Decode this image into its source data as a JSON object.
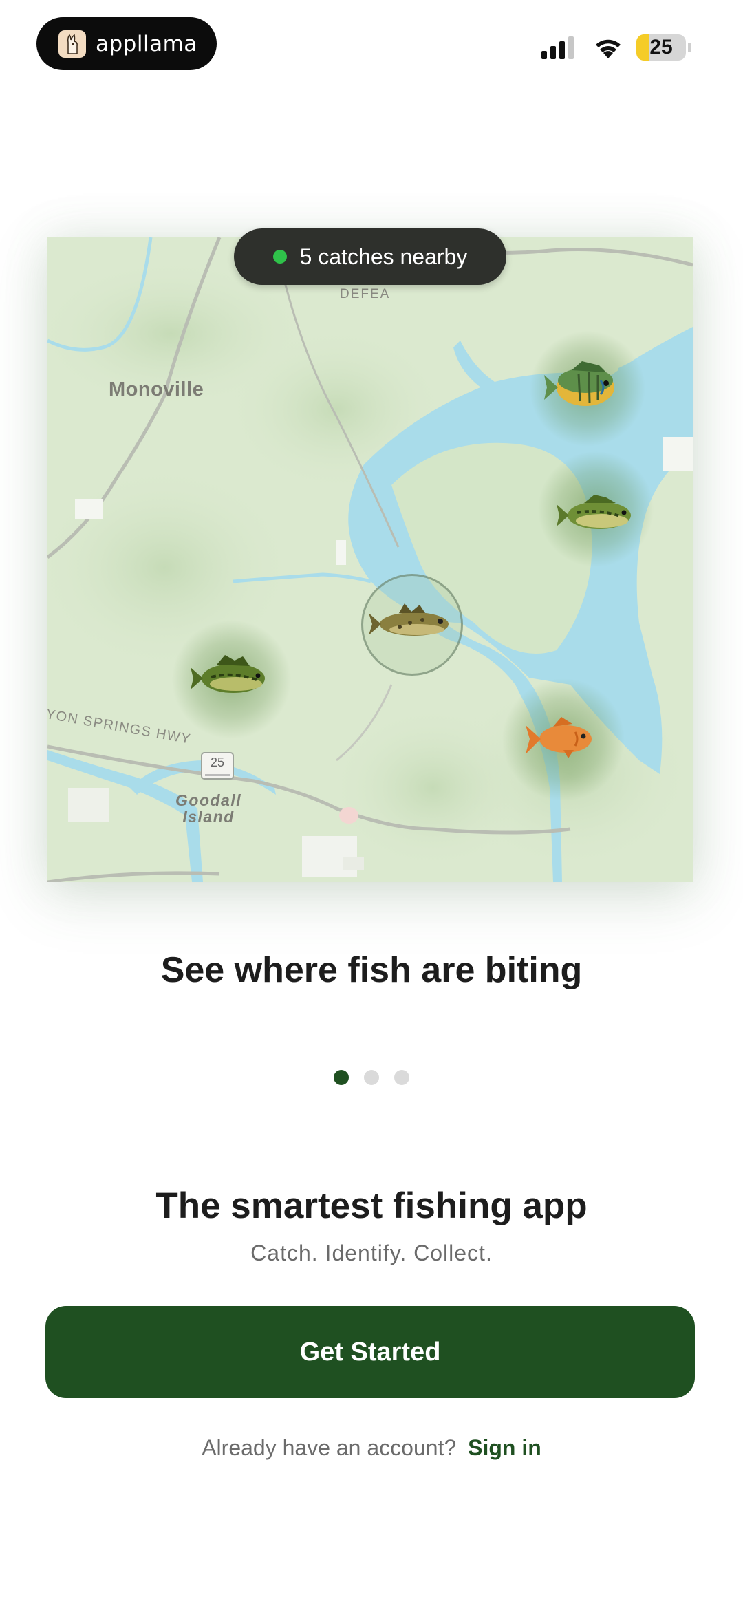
{
  "status_bar": {
    "brand_name": "appllama",
    "battery_level": "25",
    "battery_fraction": 0.25,
    "icons": [
      "cellular-signal-icon",
      "wifi-icon",
      "battery-icon"
    ]
  },
  "map": {
    "nearby_badge": "5 catches nearby",
    "labels": {
      "town": "Monoville",
      "island_line1": "Goodall",
      "island_line2": "Island",
      "road": "YON SPRINGS HWY",
      "road_top": "DEFEA",
      "route_shield": "25"
    },
    "markers": [
      "bluegill-fish-icon",
      "bass-fish-icon",
      "walleye-fish-icon",
      "bass-fish-icon",
      "goldfish-icon"
    ],
    "selected_marker": "walleye-fish-icon"
  },
  "carousel": {
    "caption": "See where fish are biting",
    "page_count": 3,
    "active_page": 1
  },
  "onboarding": {
    "headline": "The smartest fishing app",
    "subhead": "Catch. Identify. Collect.",
    "cta_label": "Get Started",
    "signin_prompt": "Already have an account?",
    "signin_link": "Sign in"
  },
  "colors": {
    "accent_green": "#1f5021",
    "nearby_dot": "#2fc24a",
    "water": "#a9dcea",
    "land": "#dbe9cf"
  }
}
